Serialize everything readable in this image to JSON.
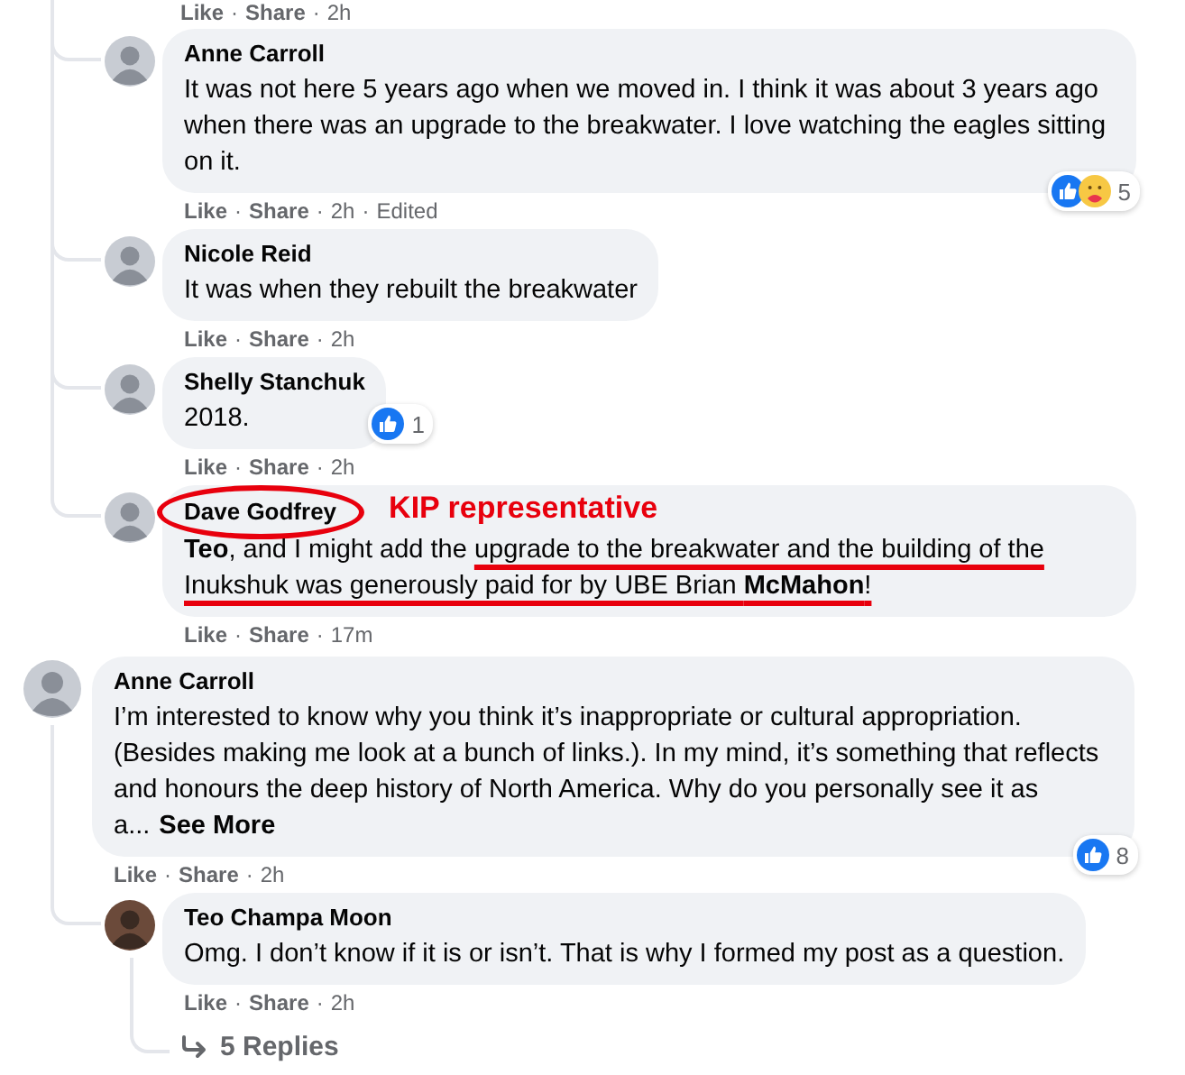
{
  "separator": "·",
  "previous_reply_meta": [
    {
      "text": "Like",
      "kind": "action"
    },
    {
      "text": "Share",
      "kind": "action"
    },
    {
      "text": "2h",
      "kind": "time"
    }
  ],
  "thread_replies": [
    {
      "author": "Anne Carroll",
      "body": [
        {
          "text": "It was not here 5 years ago when we moved in. I think it was about 3 years ago when there was an upgrade to the breakwater. I love watching the eagles sitting on it.",
          "underlined": false
        }
      ],
      "meta": [
        {
          "text": "Like",
          "kind": "action"
        },
        {
          "text": "Share",
          "kind": "action"
        },
        {
          "text": "2h",
          "kind": "time"
        },
        {
          "text": "Edited",
          "kind": "note"
        }
      ],
      "reactions": {
        "icons": [
          {
            "kind": "like"
          },
          {
            "kind": "care"
          }
        ],
        "count": "5"
      }
    },
    {
      "author": "Nicole Reid",
      "body": [
        {
          "text": "It was when they rebuilt the breakwater",
          "underlined": false
        }
      ],
      "meta": [
        {
          "text": "Like",
          "kind": "action"
        },
        {
          "text": "Share",
          "kind": "action"
        },
        {
          "text": "2h",
          "kind": "time"
        }
      ]
    },
    {
      "author": "Shelly Stanchuk",
      "body": [
        {
          "text": "2018.",
          "underlined": false
        }
      ],
      "meta": [
        {
          "text": "Like",
          "kind": "action"
        },
        {
          "text": "Share",
          "kind": "action"
        },
        {
          "text": "2h",
          "kind": "time"
        }
      ],
      "reactions": {
        "icons": [
          {
            "kind": "like"
          }
        ],
        "count": "1"
      }
    },
    {
      "author": "Dave Godfrey",
      "annotation": {
        "circled": true,
        "label": "KIP representative"
      },
      "body": [
        {
          "text": "**Teo**, and I might add the ",
          "underlined": false
        },
        {
          "text": "upgrade to the breakwater and the building of the Inukshuk was generously paid for by UBE Brian **McMahon**!",
          "underlined": true
        }
      ],
      "meta": [
        {
          "text": "Like",
          "kind": "action"
        },
        {
          "text": "Share",
          "kind": "action"
        },
        {
          "text": "17m",
          "kind": "time"
        }
      ]
    }
  ],
  "comment": {
    "author": "Anne Carroll",
    "body": [
      {
        "text": "I’m interested to know why you think it’s inappropriate or cultural appropriation. (Besides making me look at a bunch of links.). In my mind, it’s something that reflects and honours the deep history of North America. Why do you personally see it as a...",
        "underlined": false
      }
    ],
    "see_more": "See More",
    "meta": [
      {
        "text": "Like",
        "kind": "action"
      },
      {
        "text": "Share",
        "kind": "action"
      },
      {
        "text": "2h",
        "kind": "time"
      }
    ],
    "reactions": {
      "icons": [
        {
          "kind": "like"
        }
      ],
      "count": "8"
    },
    "replies": [
      {
        "author": "Teo Champa Moon",
        "body": [
          {
            "text": "Omg. I don’t know if it is or isn’t. That is why I formed my post as a question.",
            "underlined": false
          }
        ],
        "meta": [
          {
            "text": "Like",
            "kind": "action"
          },
          {
            "text": "Share",
            "kind": "action"
          },
          {
            "text": "2h",
            "kind": "time"
          }
        ]
      }
    ],
    "more_replies": "5 Replies"
  }
}
